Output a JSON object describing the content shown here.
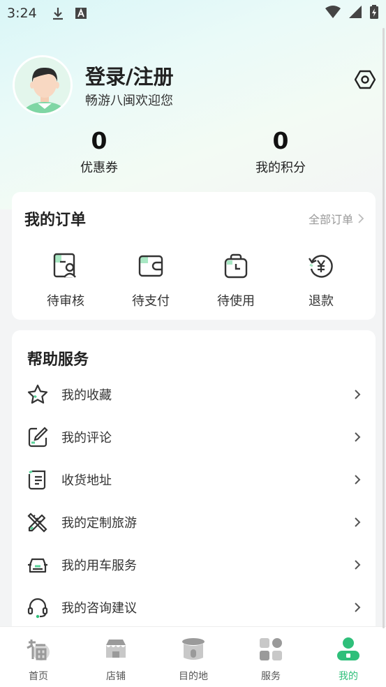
{
  "status_bar": {
    "time": "3:24",
    "icons": [
      "download-icon",
      "font-a-icon"
    ],
    "right_icons": [
      "wifi-icon",
      "signal-icon",
      "battery-charging-icon"
    ]
  },
  "profile": {
    "title": "登录/注册",
    "welcome": "畅游八闽欢迎您",
    "settings_icon": "settings-hexagon-icon"
  },
  "stats": [
    {
      "value": "0",
      "label": "优惠券"
    },
    {
      "value": "0",
      "label": "我的积分"
    }
  ],
  "orders": {
    "title": "我的订单",
    "all_label": "全部订单",
    "items": [
      {
        "label": "待审核",
        "icon": "review-icon"
      },
      {
        "label": "待支付",
        "icon": "wallet-icon"
      },
      {
        "label": "待使用",
        "icon": "clock-bag-icon"
      },
      {
        "label": "退款",
        "icon": "refund-yen-icon"
      }
    ]
  },
  "help": {
    "title": "帮助服务",
    "items": [
      {
        "label": "我的收藏",
        "icon": "star-icon"
      },
      {
        "label": "我的评论",
        "icon": "edit-icon"
      },
      {
        "label": "收货地址",
        "icon": "address-note-icon"
      },
      {
        "label": "我的定制旅游",
        "icon": "pencil-ruler-icon"
      },
      {
        "label": "我的用车服务",
        "icon": "car-seat-icon"
      },
      {
        "label": "我的咨询建议",
        "icon": "headset-icon"
      }
    ]
  },
  "tabbar": {
    "items": [
      {
        "label": "首页",
        "icon": "home-fu-icon"
      },
      {
        "label": "店铺",
        "icon": "store-icon"
      },
      {
        "label": "目的地",
        "icon": "destination-tulou-icon"
      },
      {
        "label": "服务",
        "icon": "services-grid-icon"
      },
      {
        "label": "我的",
        "icon": "profile-icon"
      }
    ],
    "active": "我的"
  },
  "colors": {
    "accent": "#2fbf7a",
    "icon_stroke": "#333333",
    "icon_green": "#a9e8c4"
  }
}
